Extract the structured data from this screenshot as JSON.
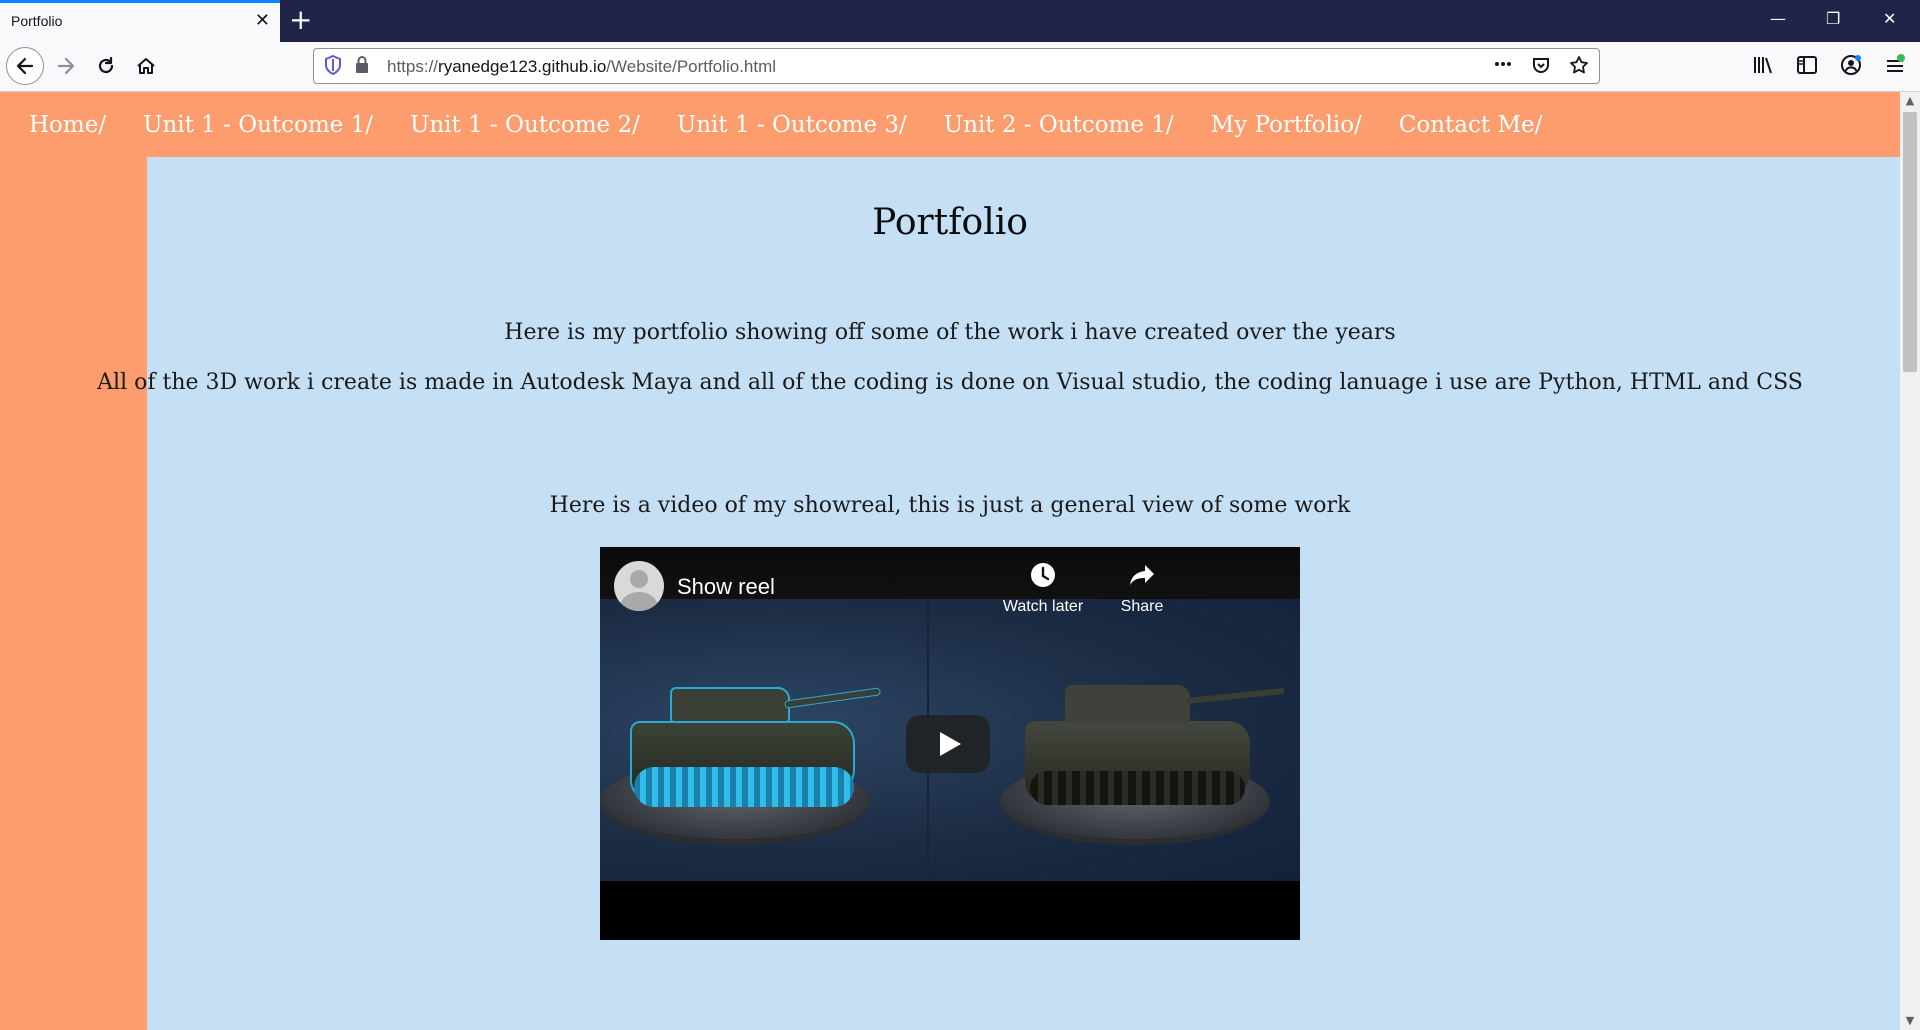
{
  "browser": {
    "tab_title": "Portfolio",
    "tab_close": "✕",
    "new_tab": "+",
    "url_prefix": "https://",
    "url_host": "ryanedge123.github.io",
    "url_path": "/Website/Portfolio.html",
    "window_controls": {
      "minimize": "—",
      "restore": "❐",
      "close": "✕"
    }
  },
  "nav": {
    "items": [
      {
        "label": "Home/"
      },
      {
        "label": "Unit 1 - Outcome 1/"
      },
      {
        "label": "Unit 1 - Outcome 2/"
      },
      {
        "label": "Unit 1 - Outcome 3/"
      },
      {
        "label": "Unit 2 - Outcome 1/"
      },
      {
        "label": "My Portfolio/"
      },
      {
        "label": "Contact Me/"
      }
    ]
  },
  "page": {
    "title": "Portfolio",
    "intro_1": "Here is my portfolio showing off some of the work i have created over the years",
    "intro_2": "All of the 3D work i create is made in Autodesk Maya and all of the coding is done on Visual studio, the coding lanuage i use are Python, HTML and CSS",
    "video_caption": "Here is a video of my showreal, this is just a general view of some work"
  },
  "video": {
    "title": "Show reel",
    "watch_later": "Watch later",
    "share": "Share"
  },
  "colors": {
    "nav_bg": "#fd9d6e",
    "page_bg": "#c5dff5",
    "tab_bar_bg": "#1f2448"
  }
}
